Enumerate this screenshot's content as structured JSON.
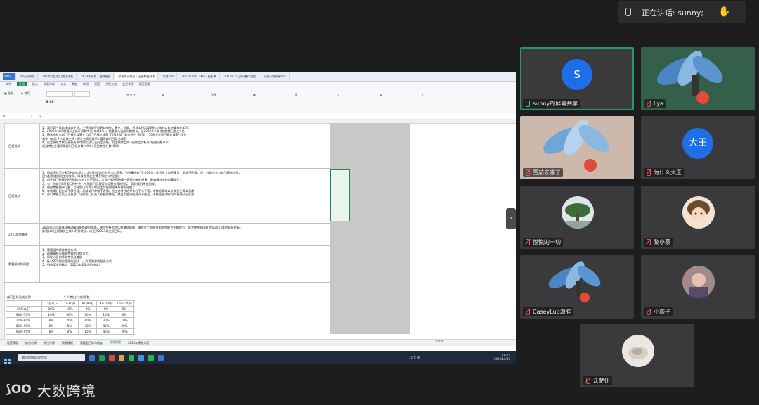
{
  "speaking": {
    "label": "正在讲话: sunny;"
  },
  "participants": [
    {
      "name": "sunny的屏幕共享",
      "avatar_text": "S",
      "muted": false
    },
    {
      "name": "liya",
      "muted": true
    },
    {
      "name": "雪茄去哪了",
      "muted": true
    },
    {
      "name": "为什么大王",
      "avatar_text": "大王",
      "muted": true
    },
    {
      "name": "悦悦的一切",
      "muted": true
    },
    {
      "name": "黎小蔡",
      "muted": true
    },
    {
      "name": "CaseyLuo潮胖",
      "muted": true
    },
    {
      "name": "小燕子",
      "muted": true
    },
    {
      "name": "沃萨妍",
      "muted": true
    }
  ],
  "logo": {
    "text": "大数跨境"
  },
  "spreadsheet": {
    "tabs": [
      "WPS",
      "市场采购版",
      "2023年度_部门费用计划",
      "2023年计划 - 营销报表",
      "综合年计划表 - 运营数据列表",
      "年度xlsx",
      "2023年11月 - KPI - 报价单",
      "2023年11_部分整体流程",
      "下发计划表格xlsx"
    ],
    "menu": [
      "文件",
      "开始",
      "插入",
      "页面布局",
      "公式",
      "数据",
      "审阅",
      "视图",
      "开发工具",
      "会员专享",
      "稻壳资源"
    ],
    "active_menu": "开始",
    "cell_ref": "O2",
    "fx": "fx",
    "rows": [
      {
        "label": "目前现状",
        "lines": [
          "1、我们是一家跨境电商企业，主营欧美亚马逊站销售，客户、销量、目前实行月度绩效考核并以此计算年终奖励；",
          "2、2022年公司聘请同业标杆薪酬专员(年薪1%)，销量收入远超同期增长，当2022年7月份销售额已超过4亿",
          "3、绩效考核与部门目标达成率+（部门目标达成率*70%+部门综合评价*30%）*50%+公司目标达成率*50%",
          "   其中（店员个人绩效工资+课长工资绩效率+管理部门目标达成率",
          "4、员工绩效考核后直接影响年终奖励以及员工评级，员工绩效工资=绩效工资标准*绩效分数/100",
          "   绩效考核主要采用部门目标分数*40%+项目考核分数*60%"
        ]
      },
      {
        "label": "目前现状",
        "lines": [
          "1、销售团队至今有5名核心员工，超过100分的人员占比不多，分数集中在70-100分，优秀员工和平庸员工差距不明显，员工分组完全与部门绩效挂钩，",
          "没有起到激励员工的作用，导致优秀员工得不到应有的回报；",
          "2、由于部门经理的KPI指标与员工并不同步，考核一套KPI指标一套得出来的结果，影响最终考核的真实性；",
          "3、有一些部门KPI指标弹性大，个别部门经理没有设置合理的目标，导致最后考核困难；",
          "4、绩效考核结果可靠，导致部门负责人和员工对绩效结果存在不理解；",
          "5、年终奖分配方式不够合理，总部部门考核不透明，员工对考核结果存在不公平感，考核结果难以反映员工真实贡献；",
          "6、部门考核方式过于复杂，导致部门负责人积极性降低，并且奖金分配方式不规范，不能在合理时间内合理分配奖金"
        ]
      },
      {
        "label": "2023年的需求",
        "lines": [
          "2023年公司要继续推进精细化管理的思路，建立完善的团队和激励机制，确保员工积极性和营销能力不断提升，努力使营销团队完成2023年的业绩目标，",
          "实现公司业绩和员工收入的双增长，以达到2023年业绩目标。"
        ]
      },
      {
        "label": "需要解决的问题",
        "lines": [
          "1、管理层的绩效考核方式",
          "2、薪酬福利与绩效考核的挂钩方式",
          "3、研发人员的绩效考核及激励",
          "4、针对不同岗位管理的现状，人力资源部的配合方式",
          "5、销售奖金的核定（2022年度奖金的核定）"
        ]
      }
    ],
    "small_table": {
      "title": "个人考核分对应系数",
      "header_left": "部门目标达成比例",
      "headers": [
        "71分以下",
        "71-80分",
        "81-90分",
        "91-100分",
        "101-120分"
      ],
      "body": [
        [
          "60%以下",
          "80%",
          "10%",
          "0%",
          "0%",
          "0%"
        ],
        [
          "60%-70%",
          "10%",
          "60%",
          "30%",
          "10%",
          "0%"
        ],
        [
          "71%-80%",
          "8%",
          "20%",
          "40%",
          "30%",
          "10%"
        ],
        [
          "81%-90%",
          "6%",
          "5%",
          "30%",
          "45%",
          "20%"
        ],
        [
          "91%-95%",
          "6%",
          "0%",
          "15%",
          "45%",
          "20%"
        ]
      ]
    },
    "sheet_tabs": [
      "运营模版",
      "综合利润",
      "职位打标",
      "周报模板",
      "管理层目标与制度",
      "绩效管理",
      "2023年绩效方案"
    ],
    "active_sheet": "绩效管理",
    "zoom": "100%",
    "taskbar_search": "输入你想搜索的内容",
    "weather": "11°C 阴",
    "time": "16:14",
    "date": "2022/12/30"
  }
}
